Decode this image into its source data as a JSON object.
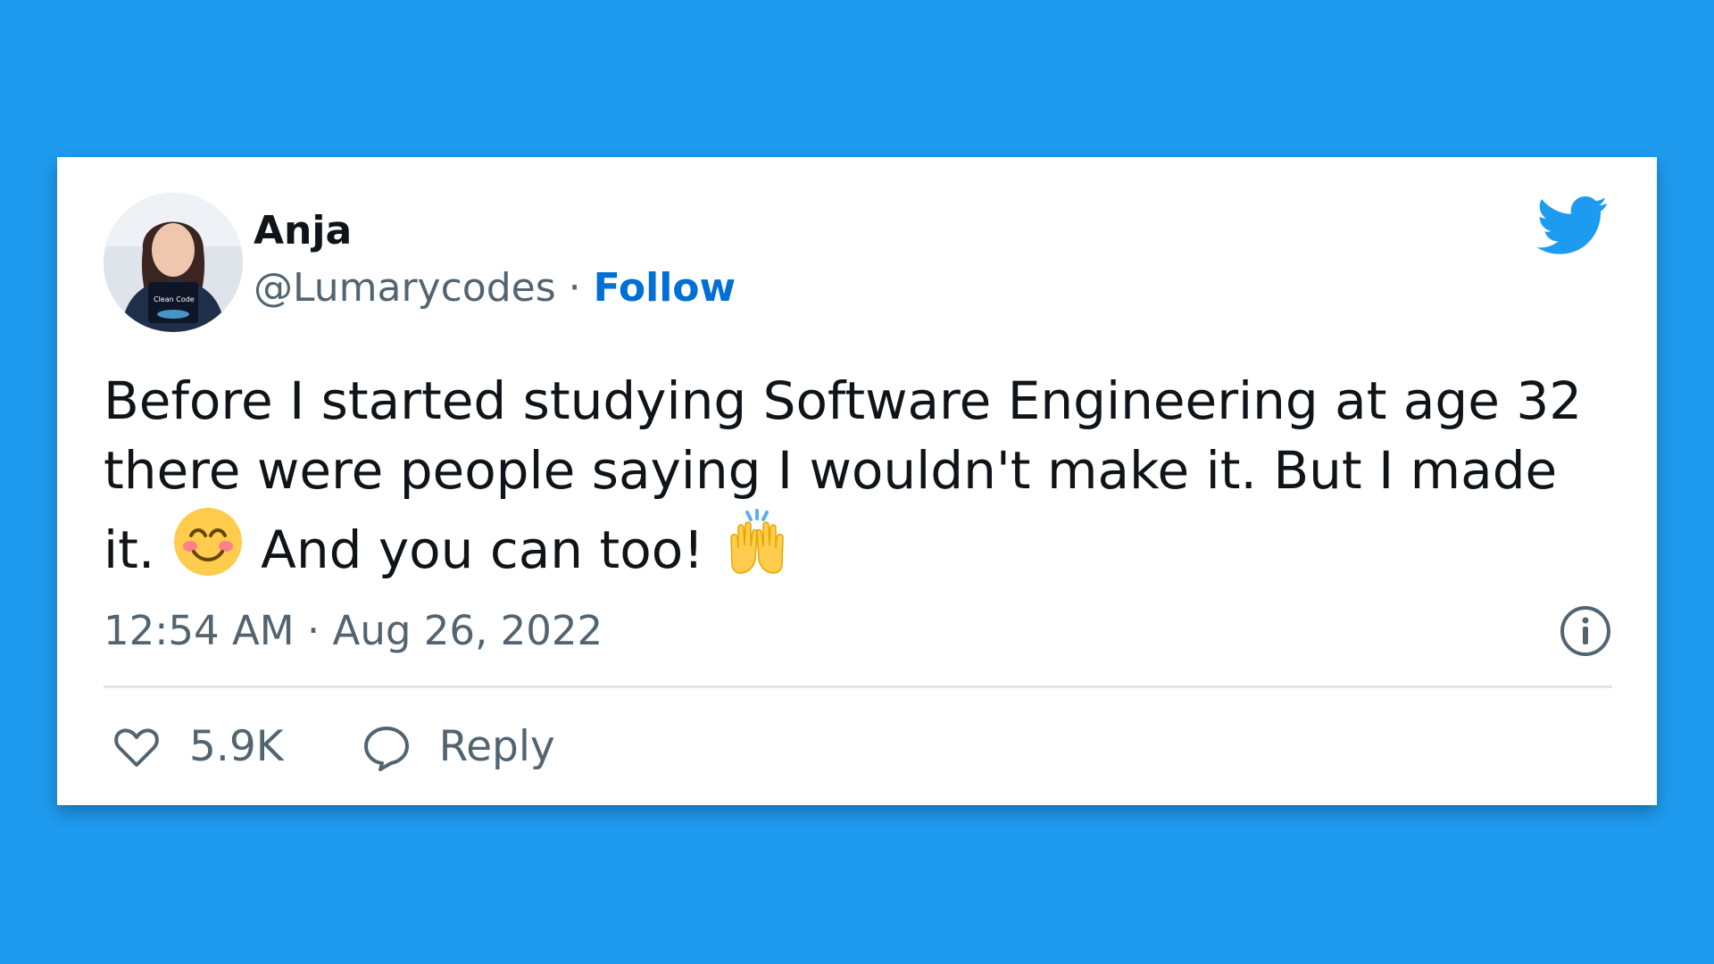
{
  "author": {
    "name": "Anja",
    "handle": "@Lumarycodes",
    "separator": "·",
    "follow_label": "Follow",
    "avatar_book_text": "Clean Code"
  },
  "tweet": {
    "line1": "Before I started studying Software Engineering at age 32",
    "line2": "there were people saying I wouldn't make it. But I made",
    "line3_start": "it.",
    "line3_mid": "And you can too!",
    "emojis": [
      "smiling-face-icon",
      "raising-hands-icon"
    ]
  },
  "meta": {
    "time": "12:54 AM",
    "separator": "·",
    "date": "Aug 26, 2022"
  },
  "actions": {
    "likes_count": "5.9K",
    "reply_label": "Reply"
  },
  "icons": {
    "brand": "twitter-bird-icon",
    "info": "info-icon",
    "like": "heart-icon",
    "reply": "speech-bubble-icon"
  },
  "colors": {
    "background": "#1e9bef",
    "brand_blue": "#1d9bf0",
    "follow_blue": "#006fd6",
    "text_primary": "#0f1419",
    "text_secondary": "#536471"
  }
}
